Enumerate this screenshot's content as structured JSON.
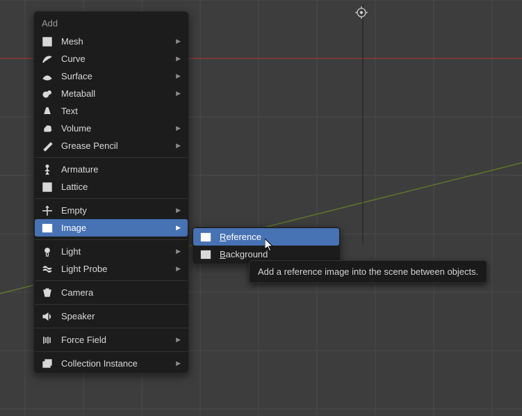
{
  "menu": {
    "title": "Add",
    "groups": [
      [
        {
          "icon": "mesh",
          "label": "Mesh",
          "sub": true
        },
        {
          "icon": "curve",
          "label": "Curve",
          "sub": true
        },
        {
          "icon": "surface",
          "label": "Surface",
          "sub": true
        },
        {
          "icon": "metaball",
          "label": "Metaball",
          "sub": true
        },
        {
          "icon": "text",
          "label": "Text",
          "sub": false
        },
        {
          "icon": "volume",
          "label": "Volume",
          "sub": true
        },
        {
          "icon": "greasepencil",
          "label": "Grease Pencil",
          "sub": true
        }
      ],
      [
        {
          "icon": "armature",
          "label": "Armature",
          "sub": false
        },
        {
          "icon": "lattice",
          "label": "Lattice",
          "sub": false
        }
      ],
      [
        {
          "icon": "empty",
          "label": "Empty",
          "sub": true
        },
        {
          "icon": "image",
          "label": "Image",
          "sub": true,
          "selected": true
        }
      ],
      [
        {
          "icon": "light",
          "label": "Light",
          "sub": true
        },
        {
          "icon": "lightprobe",
          "label": "Light Probe",
          "sub": true
        }
      ],
      [
        {
          "icon": "camera",
          "label": "Camera",
          "sub": false
        }
      ],
      [
        {
          "icon": "speaker",
          "label": "Speaker",
          "sub": false
        }
      ],
      [
        {
          "icon": "forcefield",
          "label": "Force Field",
          "sub": true
        }
      ],
      [
        {
          "icon": "collection",
          "label": "Collection Instance",
          "sub": true
        }
      ]
    ]
  },
  "submenu": {
    "items": [
      {
        "icon": "img-ref",
        "label": "Reference",
        "u": 0,
        "selected": true
      },
      {
        "icon": "img-bg",
        "label": "Background",
        "u": 0,
        "selected": false
      }
    ]
  },
  "tooltip": "Add a reference image into the scene between objects."
}
